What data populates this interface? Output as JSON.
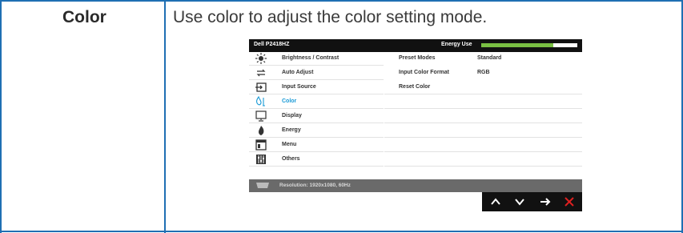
{
  "table": {
    "label": "Color",
    "description": "Use color to adjust the color setting mode."
  },
  "osd": {
    "model": "Dell P2418HZ",
    "energy_label": "Energy Use",
    "menu": [
      {
        "label": "Brightness / Contrast",
        "icon": "brightness-icon"
      },
      {
        "label": "Auto Adjust",
        "icon": "auto-adjust-icon"
      },
      {
        "label": "Input Source",
        "icon": "input-source-icon"
      },
      {
        "label": "Color",
        "icon": "color-icon",
        "active": true
      },
      {
        "label": "Display",
        "icon": "display-icon"
      },
      {
        "label": "Energy",
        "icon": "energy-icon"
      },
      {
        "label": "Menu",
        "icon": "menu-icon"
      },
      {
        "label": "Others",
        "icon": "others-icon"
      }
    ],
    "content": [
      {
        "key": "Preset Modes",
        "value": "Standard"
      },
      {
        "key": "Input Color Format",
        "value": "RGB"
      },
      {
        "key": "Reset Color",
        "value": ""
      }
    ],
    "status_text": "Resolution: 1920x1080, 60Hz",
    "energy_level": 0.75,
    "nav_buttons": [
      "up-arrow-icon",
      "down-arrow-icon",
      "right-arrow-icon",
      "close-icon"
    ],
    "colors": {
      "accent": "#1a9ad6",
      "energy": "#7ac043",
      "close": "#e02020",
      "border": "#1f6fb3"
    }
  }
}
